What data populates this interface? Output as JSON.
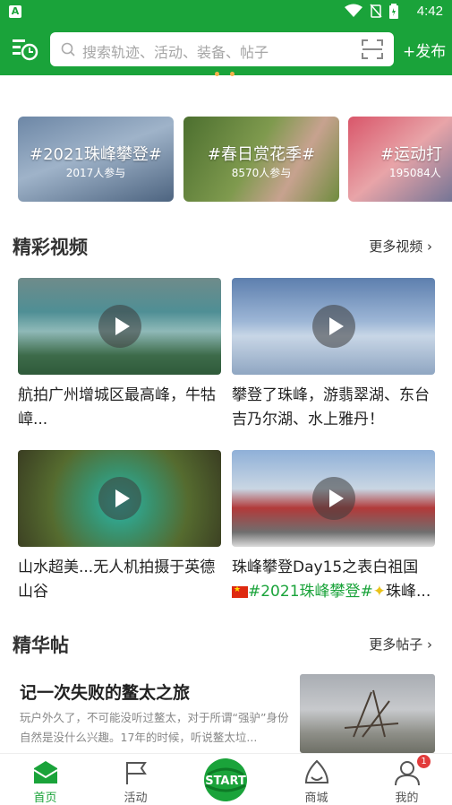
{
  "status_bar": {
    "time": "4:42",
    "app_icon_letter": "A"
  },
  "header": {
    "search_placeholder": "搜索轨迹、活动、装备、帖子",
    "publish_label": "+发布",
    "accent_color": "#1aa33a"
  },
  "topics": [
    {
      "title": "#2021珠峰攀登#",
      "count": "2017人参与"
    },
    {
      "title": "#春日赏花季#",
      "count": "8570人参与"
    },
    {
      "title": "#运动打",
      "count": "195084人"
    }
  ],
  "videos_section": {
    "title": "精彩视频",
    "more": "更多视频",
    "items": [
      {
        "title": "航拍广州增城区最高峰，牛牯嶂..."
      },
      {
        "title": "攀登了珠峰，游翡翠湖、东台吉乃尔湖、水上雅丹！"
      },
      {
        "title": "山水超美...无人机拍摄于英德山谷"
      },
      {
        "title": "珠峰攀登Day15之表白祖国",
        "tag": "#2021珠峰攀登#",
        "tail": "珠峰..."
      }
    ]
  },
  "posts_section": {
    "title": "精华帖",
    "more": "更多帖子",
    "items": [
      {
        "title": "记一次失败的鳌太之旅",
        "excerpt": "玩户外久了，不可能没听过鳌太，对于所谓“强驴”身份自然是没什么兴趣。17年的时候，听说鳌太垃..."
      }
    ]
  },
  "tabbar": {
    "tabs": [
      {
        "label": "首页",
        "active": true
      },
      {
        "label": "活动"
      },
      {
        "label": "START"
      },
      {
        "label": "商城"
      },
      {
        "label": "我的",
        "badge": "1"
      }
    ]
  }
}
